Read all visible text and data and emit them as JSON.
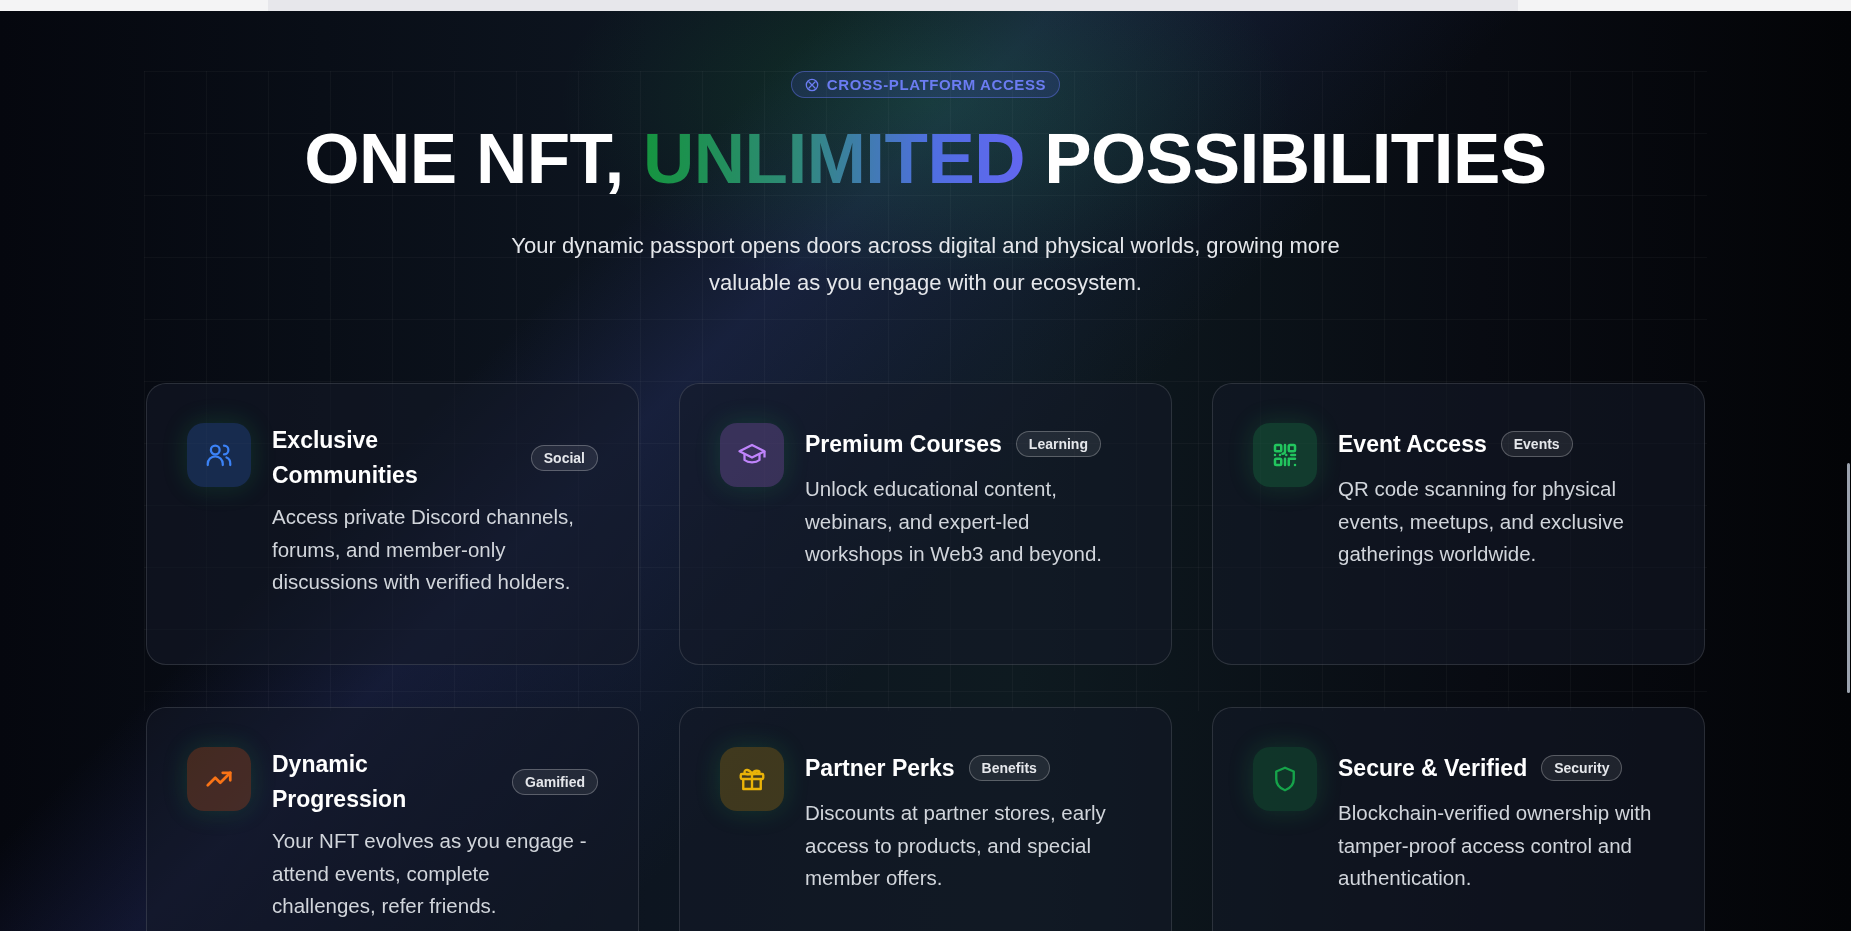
{
  "badge": {
    "label": "CROSS-PLATFORM ACCESS"
  },
  "heading": {
    "start": "ONE NFT,",
    "highlight": "UNLIMITED",
    "end": "POSSIBILITIES"
  },
  "subtitle": "Your dynamic passport opens doors across digital and physical worlds, growing more valuable as you engage with our ecosystem.",
  "features": [
    {
      "title": "Exclusive Communities",
      "tag": "Social",
      "description": "Access private Discord channels, forums, and member-only discussions with verified holders.",
      "color": "#3b82f6"
    },
    {
      "title": "Premium Courses",
      "tag": "Learning",
      "description": "Unlock educational content, webinars, and expert-led workshops in Web3 and beyond.",
      "color": "#c084fc"
    },
    {
      "title": "Event Access",
      "tag": "Events",
      "description": "QR code scanning for physical events, meetups, and exclusive gatherings worldwide.",
      "color": "#22c55e"
    },
    {
      "title": "Dynamic Progression",
      "tag": "Gamified",
      "description": "Your NFT evolves as you engage - attend events, complete challenges, refer friends.",
      "color": "#f97316"
    },
    {
      "title": "Partner Perks",
      "tag": "Benefits",
      "description": "Discounts at partner stores, early access to products, and special member offers.",
      "color": "#eab308"
    },
    {
      "title": "Secure & Verified",
      "tag": "Security",
      "description": "Blockchain-verified ownership with tamper-proof access control and authentication.",
      "color": "#16a34a"
    }
  ]
}
